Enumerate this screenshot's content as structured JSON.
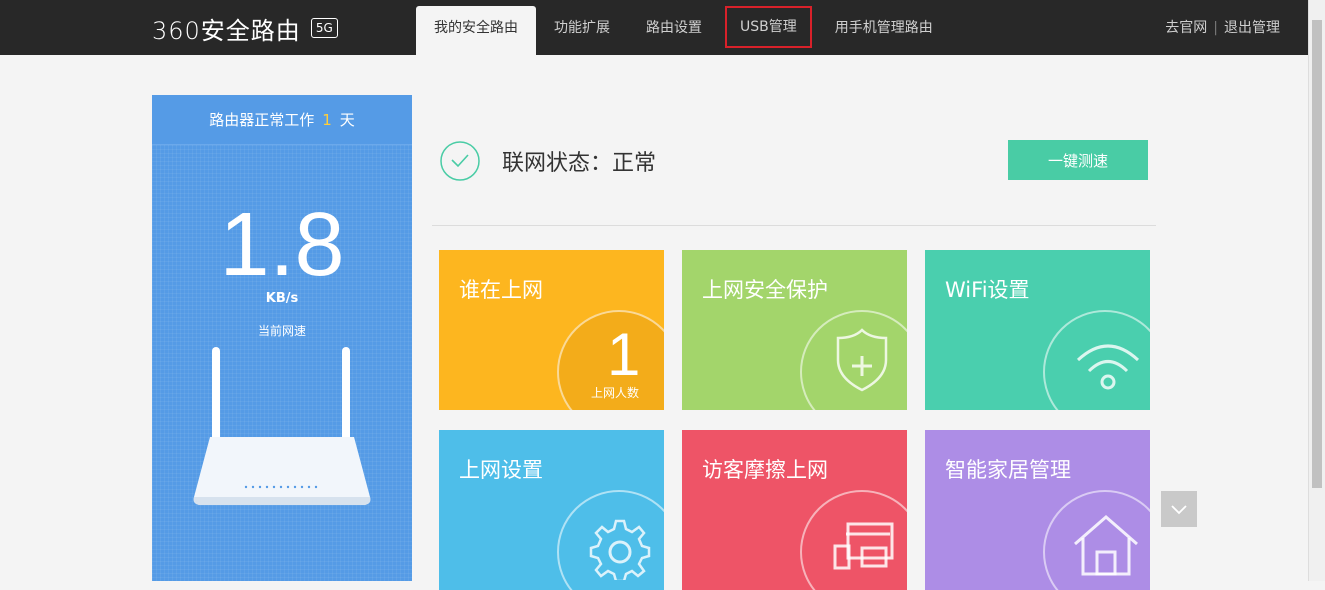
{
  "header": {
    "logo": "360安全路由",
    "logo_badge": "5G",
    "tabs": [
      "我的安全路由",
      "功能扩展",
      "路由设置",
      "USB管理",
      "用手机管理路由"
    ],
    "links": [
      "去官网",
      "退出管理"
    ]
  },
  "status_panel": {
    "uptime_prefix": "路由器正常工作",
    "uptime_days": "1",
    "uptime_suffix": "天",
    "speed_value": "1.8",
    "speed_unit": "KB/s",
    "speed_label": "当前网速"
  },
  "network": {
    "status_text": "联网状态：正常",
    "speedtest_label": "一键测速"
  },
  "tiles": [
    {
      "title": "谁在上网",
      "color": "#fdb61f",
      "count": "1",
      "count_label": "上网人数"
    },
    {
      "title": "上网安全保护",
      "color": "#a3d56b"
    },
    {
      "title": "WiFi设置",
      "color": "#4acfae"
    },
    {
      "title": "上网设置",
      "color": "#4ebee9"
    },
    {
      "title": "访客摩擦上网",
      "color": "#ee5467"
    },
    {
      "title": "智能家居管理",
      "color": "#ad8de6"
    }
  ],
  "icons": {
    "check": "check-circle-icon",
    "shield": "shield-plus-icon",
    "wifi": "wifi-icon",
    "gear": "gear-icon",
    "guest": "guest-device-icon",
    "home": "home-icon",
    "scroll": "chevron-down-icon"
  }
}
